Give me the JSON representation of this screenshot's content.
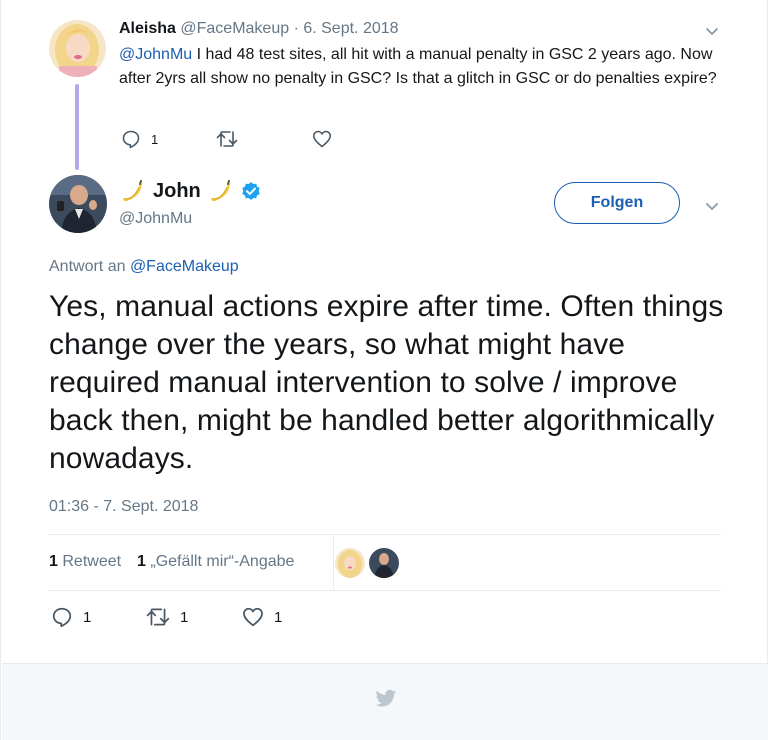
{
  "parent_tweet": {
    "name": "Aleisha",
    "handle": "@FaceMakeup",
    "separator": "·",
    "date": "6. Sept. 2018",
    "mention": "@JohnMu",
    "text": " I had 48 test sites, all hit with a manual penalty in GSC 2 years ago. Now after 2yrs all show no penalty in GSC? Is that a glitch in GSC or do penalties expire?",
    "actions": {
      "reply_count": "1",
      "retweet_count": "",
      "like_count": ""
    }
  },
  "main_tweet": {
    "name": "John",
    "handle": "@JohnMu",
    "verified": true,
    "follow_label": "Folgen",
    "reply_to_prefix": "Antwort an",
    "reply_to_handle": "@FaceMakeup",
    "text": "Yes, manual actions expire after time. Often things change over the years, so what might have required manual intervention to solve / improve back then, might be handled better algorithmically nowadays.",
    "timestamp": "01:36 - 7. Sept. 2018",
    "stats": {
      "retweet_count": "1",
      "retweet_label": "Retweet",
      "like_count": "1",
      "like_label": "„Gefällt mir“-Angabe"
    },
    "actions": {
      "reply_count": "1",
      "retweet_count": "1",
      "like_count": "1"
    }
  },
  "icons": {
    "reply": "reply-icon",
    "retweet": "retweet-icon",
    "like": "heart-icon",
    "menu": "chevron-down-icon",
    "verified": "verified-badge-icon",
    "banana": "banana-emoji-icon",
    "footer": "twitter-bird-icon"
  },
  "colors": {
    "link": "#1b5fb3",
    "secondary_text": "#657786",
    "thread_line": "#b3a8ee",
    "verified": "#1da1f2",
    "footer_bg": "#f5f8fa",
    "border": "#e6ecf0"
  }
}
